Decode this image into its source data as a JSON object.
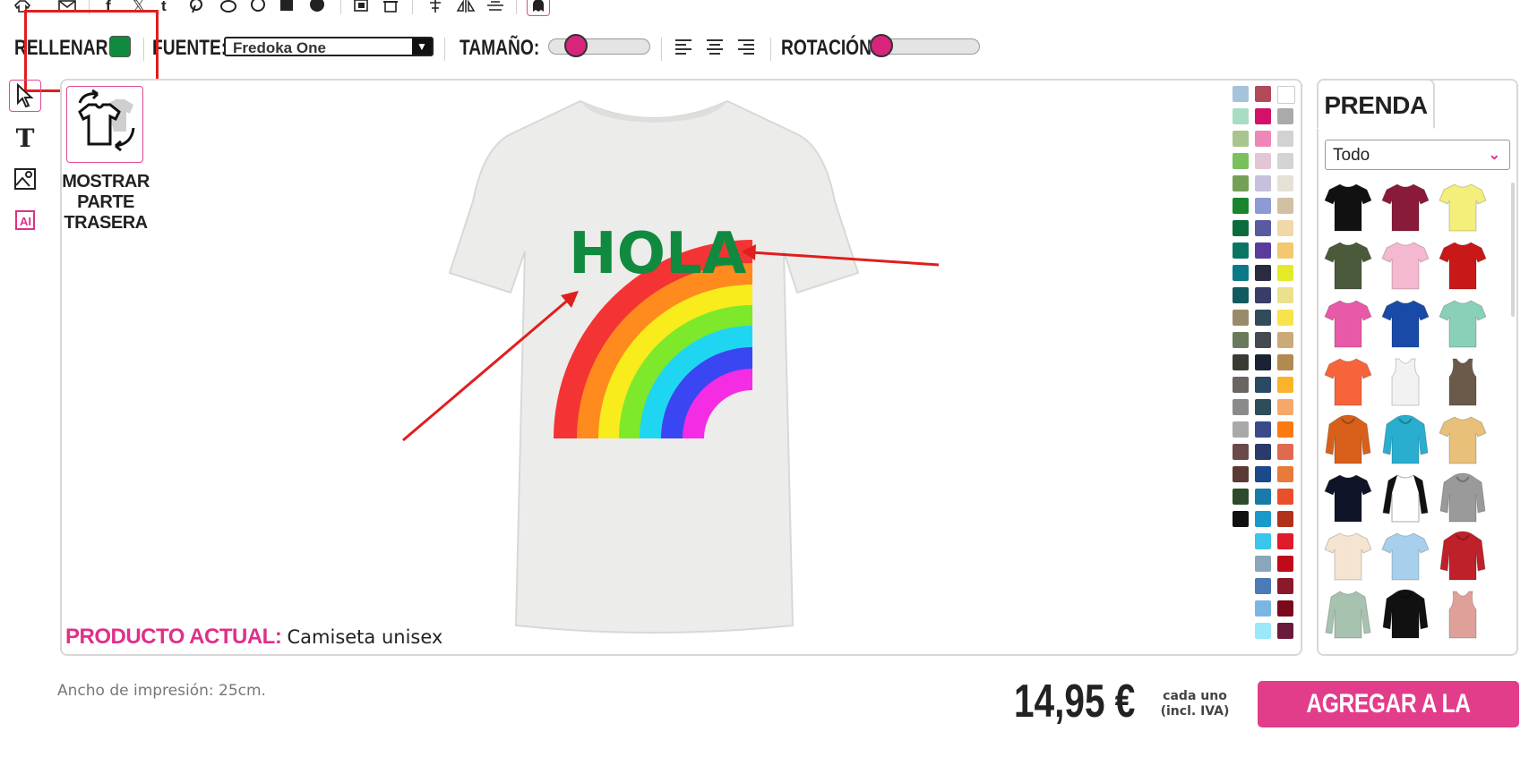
{
  "top_icons": [
    "shirt-icon",
    "mail-icon",
    "facebook-icon",
    "x-icon",
    "tumblr-icon",
    "pinterest-icon",
    "reddit-icon",
    "whatsapp-icon",
    "teams-icon",
    "telegram-icon",
    "copy-icon",
    "trash-icon",
    "align-center-icon",
    "flip-icon",
    "distribute-icon",
    "ghost-icon"
  ],
  "toolbar": {
    "fill_label": "RELLENAR:",
    "fill_color": "#0f8a3e",
    "font_label": "FUENTE:",
    "font_value": "Fredoka One",
    "size_label": "TAMAÑO:",
    "size_value": 0.2,
    "rotation_label": "ROTACIÓN:",
    "rotation_value": 0.0
  },
  "left_tools": [
    "pointer-icon",
    "text-icon",
    "image-icon",
    "ai-icon"
  ],
  "back": {
    "label_lines": [
      "MOSTRAR",
      "PARTE",
      "TRASERA"
    ]
  },
  "design": {
    "text": "HOLA",
    "text_color": "#0f8a3e"
  },
  "current_product": {
    "label": "PRODUCTO ACTUAL:",
    "value": "Camiseta unisex"
  },
  "colors": [
    [
      "#a7c3dc",
      "#b24a5a",
      "#ffffff"
    ],
    [
      "#a9dcc4",
      "#d6106a",
      "#aaaaaa"
    ],
    [
      "#a9c48d",
      "#ef86b8",
      "#d2d2d2"
    ],
    [
      "#79c15c",
      "#e4c5d5",
      "#d4d4d4"
    ],
    [
      "#74a058",
      "#c7c0dc",
      "#e6e1d6"
    ],
    [
      "#19852e",
      "#8d9ad5",
      "#d1c0a4"
    ],
    [
      "#0c6b3c",
      "#5a5aa0",
      "#f1d8a8"
    ],
    [
      "#0b7563",
      "#5a3c9a",
      "#f2c870"
    ],
    [
      "#0a7a86",
      "#2a2a40",
      "#e4ea2a"
    ],
    [
      "#115a60",
      "#3a3d68",
      "#ebe18c"
    ],
    [
      "#9a8a6c",
      "#324a5a",
      "#f8e34a"
    ],
    [
      "#6a7a5c",
      "#444a50",
      "#c9aa78"
    ],
    [
      "#3a3a32",
      "#1a2233",
      "#b08a50"
    ],
    [
      "#6a6462",
      "#2a4a64",
      "#fab32a"
    ],
    [
      "#8a8a8a",
      "#2d4d5a",
      "#f6a86a"
    ],
    [
      "#a9a9a9",
      "#3a4a8a",
      "#fb7a10"
    ],
    [
      "#6a4a4a",
      "#2a3a6a",
      "#e06a50"
    ],
    [
      "#5a3a32",
      "#1a4a8a",
      "#e87a3a"
    ],
    [
      "#2d4a2a",
      "#1a7aaa",
      "#e8502a"
    ],
    [
      "#111111",
      "#1a9acb",
      "#b0321a"
    ],
    [
      "",
      "#3ac6ea",
      "#e01a2a"
    ],
    [
      "",
      "#8aa6ba",
      "#c00a1a"
    ],
    [
      "",
      "#4a7ab8",
      "#8a1a2a"
    ],
    [
      "",
      "#7ab6e4",
      "#7a0a1a"
    ],
    [
      "",
      "#9ae8f8",
      "#6a1a3a"
    ]
  ],
  "panel": {
    "tab_label": "PRENDA",
    "category": "Todo",
    "products": [
      {
        "name": "black-tshirt",
        "color": "#111111",
        "type": "tee"
      },
      {
        "name": "burgundy-tshirt",
        "color": "#8a1a3a",
        "type": "tee"
      },
      {
        "name": "yellow-tshirt",
        "color": "#f4ee7a",
        "type": "tee"
      },
      {
        "name": "olive-tshirt",
        "color": "#4a5a3a",
        "type": "tee"
      },
      {
        "name": "pink-tshirt",
        "color": "#f4b8d0",
        "type": "tee"
      },
      {
        "name": "red-tshirt",
        "color": "#c81818",
        "type": "tee"
      },
      {
        "name": "magenta-tshirt",
        "color": "#e85aa8",
        "type": "tee"
      },
      {
        "name": "royal-tshirt",
        "color": "#1a4aa8",
        "type": "tee"
      },
      {
        "name": "mint-tshirt",
        "color": "#8ad0b8",
        "type": "tee"
      },
      {
        "name": "coral-tshirt",
        "color": "#f8643a",
        "type": "tee"
      },
      {
        "name": "white-tank",
        "color": "#f2f2f2",
        "type": "tank"
      },
      {
        "name": "brown-tank",
        "color": "#6a5a4a",
        "type": "tank"
      },
      {
        "name": "orange-hoodie",
        "color": "#d8601a",
        "type": "hoodie"
      },
      {
        "name": "turquoise-hoodie",
        "color": "#2aaed0",
        "type": "hoodie"
      },
      {
        "name": "tiedye-tshirt",
        "color": "#e8c07a",
        "type": "tee"
      },
      {
        "name": "navy-tshirt",
        "color": "#101428",
        "type": "tee"
      },
      {
        "name": "raglan-tshirt",
        "color": "#ffffff",
        "type": "raglan"
      },
      {
        "name": "grey-hoodie",
        "color": "#9a9a9a",
        "type": "hoodie"
      },
      {
        "name": "cream-tshirt",
        "color": "#f4e4d0",
        "type": "tee"
      },
      {
        "name": "skyblue-tshirt",
        "color": "#a8d0ec",
        "type": "tee"
      },
      {
        "name": "varsity-jacket",
        "color": "#c0202a",
        "type": "jacket"
      },
      {
        "name": "sage-longsleeve",
        "color": "#a8c2b0",
        "type": "long"
      },
      {
        "name": "black-orange-hoodie",
        "color": "#111111",
        "type": "hoodie"
      },
      {
        "name": "rose-tank",
        "color": "#e0a09a",
        "type": "tank"
      }
    ]
  },
  "footer": {
    "print_width": "Ancho de impresión: 25cm.",
    "price": "14,95 €",
    "each_line1": "cada uno",
    "each_line2": "(incl. IVA)",
    "cart_button": "AGREGAR A LA CESTA"
  }
}
